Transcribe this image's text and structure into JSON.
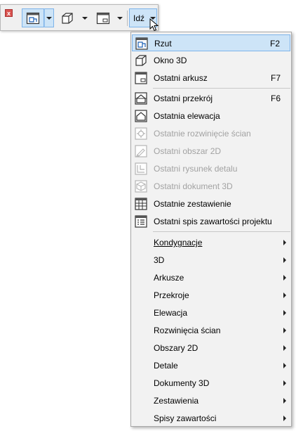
{
  "toolbar": {
    "close_label": "x",
    "go_label": "Idź",
    "buttons": [
      {
        "icon": "floor-plan-icon",
        "active": true
      },
      {
        "icon": "3d-window-icon",
        "active": false
      },
      {
        "icon": "layout-sheet-icon",
        "active": false
      }
    ]
  },
  "menu": {
    "items": [
      {
        "label": "Rzut",
        "shortcut": "F2",
        "icon": "floor-plan-icon",
        "enabled": true,
        "highlighted": true
      },
      {
        "label": "Okno 3D",
        "shortcut": "",
        "icon": "3d-window-icon",
        "enabled": true
      },
      {
        "label": "Ostatni arkusz",
        "shortcut": "F7",
        "icon": "layout-sheet-icon",
        "enabled": true
      },
      {
        "label": "Ostatni przekrój",
        "shortcut": "F6",
        "icon": "section-icon",
        "enabled": true
      },
      {
        "label": "Ostatnia elewacja",
        "shortcut": "",
        "icon": "elevation-icon",
        "enabled": true
      },
      {
        "label": "Ostatnie rozwinięcie ścian",
        "shortcut": "",
        "icon": "interior-elevation-icon",
        "enabled": false
      },
      {
        "label": "Ostatni obszar 2D",
        "shortcut": "",
        "icon": "worksheet-icon",
        "enabled": false
      },
      {
        "label": "Ostatni rysunek detalu",
        "shortcut": "",
        "icon": "detail-icon",
        "enabled": false
      },
      {
        "label": "Ostatni dokument 3D",
        "shortcut": "",
        "icon": "3d-document-icon",
        "enabled": false
      },
      {
        "label": "Ostatnie zestawienie",
        "shortcut": "",
        "icon": "schedule-icon",
        "enabled": true
      },
      {
        "label": "Ostatni spis zawartości projektu",
        "shortcut": "",
        "icon": "project-index-icon",
        "enabled": true
      }
    ],
    "submenus": [
      {
        "label": "Kondygnacje"
      },
      {
        "label": "3D"
      },
      {
        "label": "Arkusze"
      },
      {
        "label": "Przekroje"
      },
      {
        "label": "Elewacja"
      },
      {
        "label": "Rozwinięcia ścian"
      },
      {
        "label": "Obszary 2D"
      },
      {
        "label": "Detale"
      },
      {
        "label": "Dokumenty 3D"
      },
      {
        "label": "Zestawienia"
      },
      {
        "label": "Spisy zawartości"
      }
    ]
  }
}
